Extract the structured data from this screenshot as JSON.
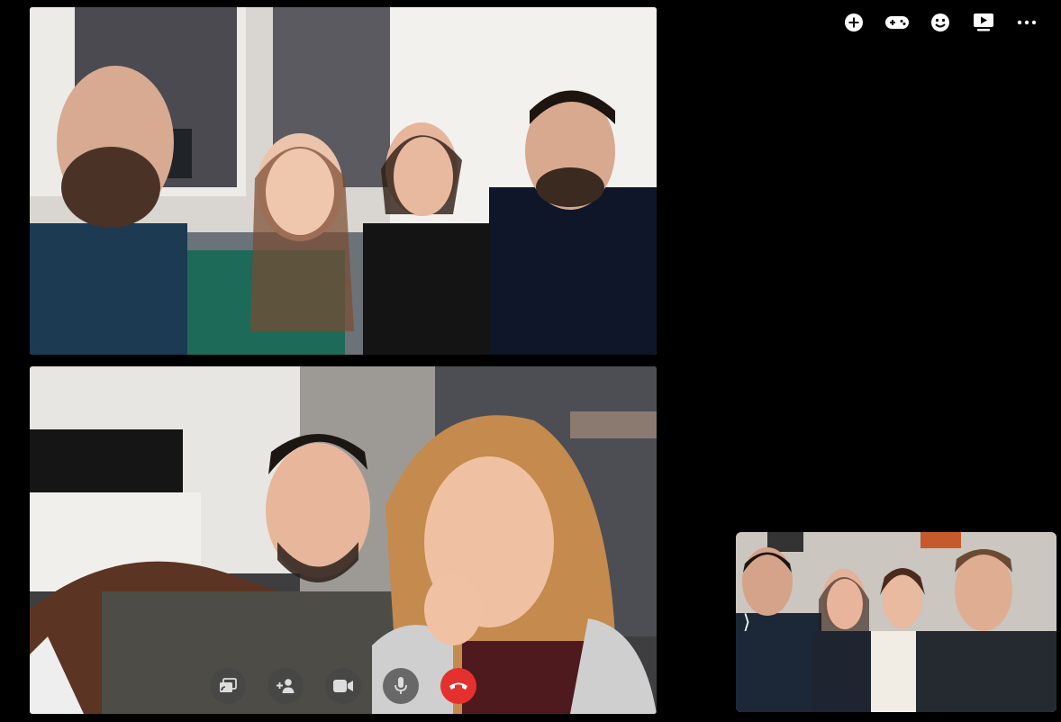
{
  "toolbar": {
    "items": [
      {
        "name": "add-icon"
      },
      {
        "name": "game-controller-icon"
      },
      {
        "name": "emoji-icon"
      },
      {
        "name": "watch-together-icon"
      },
      {
        "name": "more-options-icon"
      }
    ]
  },
  "participants": [
    {
      "tile": "remote-video-1",
      "people_count": 4
    },
    {
      "tile": "remote-video-2",
      "people_count": 2
    }
  ],
  "self_view": {
    "people_count": 4,
    "collapse_icon": "chevron-right-icon",
    "collapse_glyph": "⟩"
  },
  "call_controls": [
    {
      "name": "screen-share-icon"
    },
    {
      "name": "add-person-icon"
    },
    {
      "name": "camera-icon"
    },
    {
      "name": "microphone-icon"
    },
    {
      "name": "end-call-icon",
      "color": "#e5312e"
    }
  ],
  "colors": {
    "background": "#000000",
    "end_call": "#e5312e",
    "control_bg": "#464646"
  }
}
